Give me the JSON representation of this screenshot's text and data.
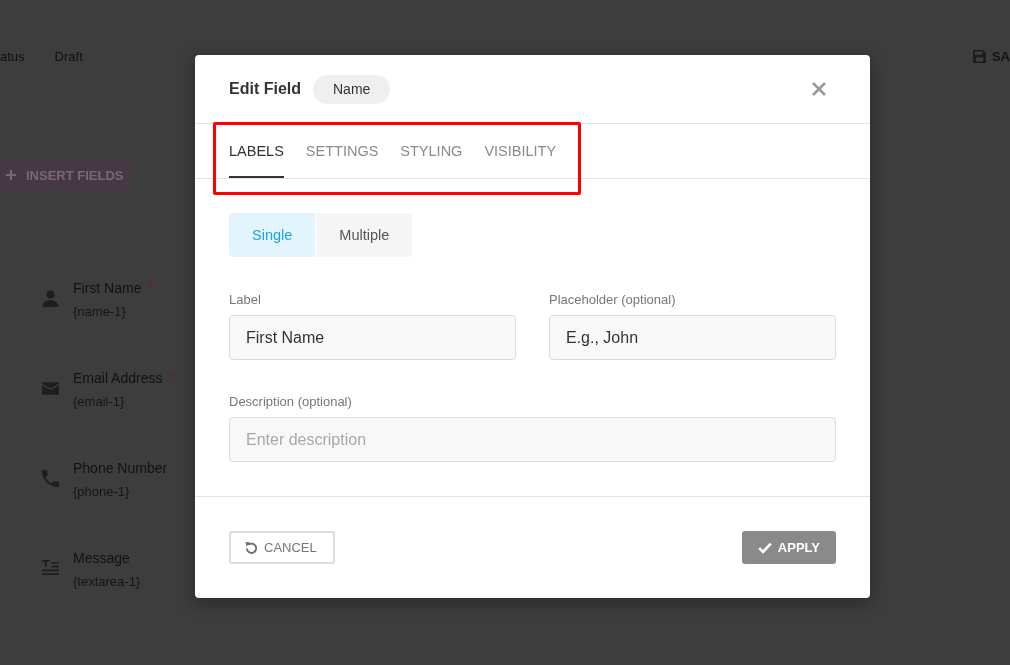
{
  "background": {
    "header": {
      "status_label": "atus",
      "status_value": "Draft",
      "save_label": "SA"
    },
    "insert_button": {
      "label": "INSERT FIELDS"
    },
    "fields": [
      {
        "kind": "name",
        "title": "First Name",
        "required": true,
        "token": "{name-1}"
      },
      {
        "kind": "email",
        "title": "Email Address",
        "required": true,
        "token": "{email-1}"
      },
      {
        "kind": "phone",
        "title": "Phone Number",
        "required": false,
        "token": "{phone-1}"
      },
      {
        "kind": "textarea",
        "title": "Message",
        "required": false,
        "token": "{textarea-1}"
      }
    ]
  },
  "dialog": {
    "title": "Edit Field",
    "field_type_chip": "Name",
    "tabs": {
      "highlighted": true,
      "items": [
        {
          "label": "LABELS",
          "selected": true
        },
        {
          "label": "SETTINGS",
          "selected": false
        },
        {
          "label": "STYLING",
          "selected": false
        },
        {
          "label": "VISIBILITY",
          "selected": false
        }
      ]
    },
    "mode_toggle": [
      {
        "label": "Single",
        "selected": true
      },
      {
        "label": "Multiple",
        "selected": false
      }
    ],
    "input_rows": [
      {
        "fields": [
          {
            "label": "Label",
            "value": "First Name"
          },
          {
            "label": "Placeholder (optional)",
            "value": "E.g., John"
          }
        ]
      },
      {
        "fields": [
          {
            "label": "Description (optional)",
            "placeholder": "Enter description"
          }
        ]
      }
    ],
    "buttons": [
      {
        "kind": "cancel",
        "label": "CANCEL"
      },
      {
        "kind": "apply",
        "label": "APPLY"
      }
    ]
  }
}
